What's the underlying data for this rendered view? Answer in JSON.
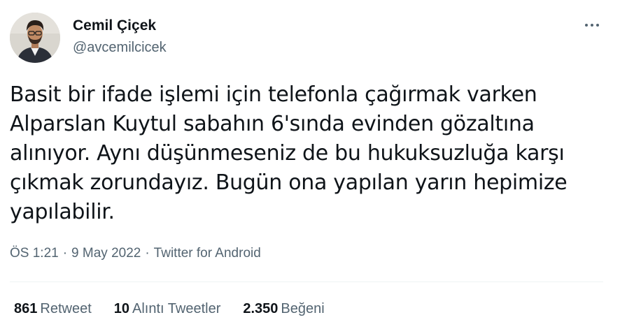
{
  "author": {
    "display_name": "Cemil Çiçek",
    "handle": "@avcemilcicek",
    "avatar_icon": "profile-photo"
  },
  "more_icon": "more-horizontal-icon",
  "tweet": {
    "text": "Basit bir ifade işlemi için telefonla çağırmak varken Alparslan Kuytul sabahın 6'sında evinden gözaltına alınıyor. Aynı düşünmeseniz de bu hukuksuzluğa karşı çıkmak zorundayız. Bugün ona yapılan yarın hepimize yapılabilir."
  },
  "meta": {
    "time": "ÖS 1:21",
    "separator": "·",
    "date": "9 May 2022",
    "source": "Twitter for Android"
  },
  "stats": {
    "retweets": {
      "count": "861",
      "label": "Retweet"
    },
    "quotes": {
      "count": "10",
      "label": "Alıntı Tweetler"
    },
    "likes": {
      "count": "2.350",
      "label": "Beğeni"
    }
  },
  "colors": {
    "text_primary": "#0f1419",
    "text_secondary": "#536471",
    "divider": "#eff3f4"
  }
}
